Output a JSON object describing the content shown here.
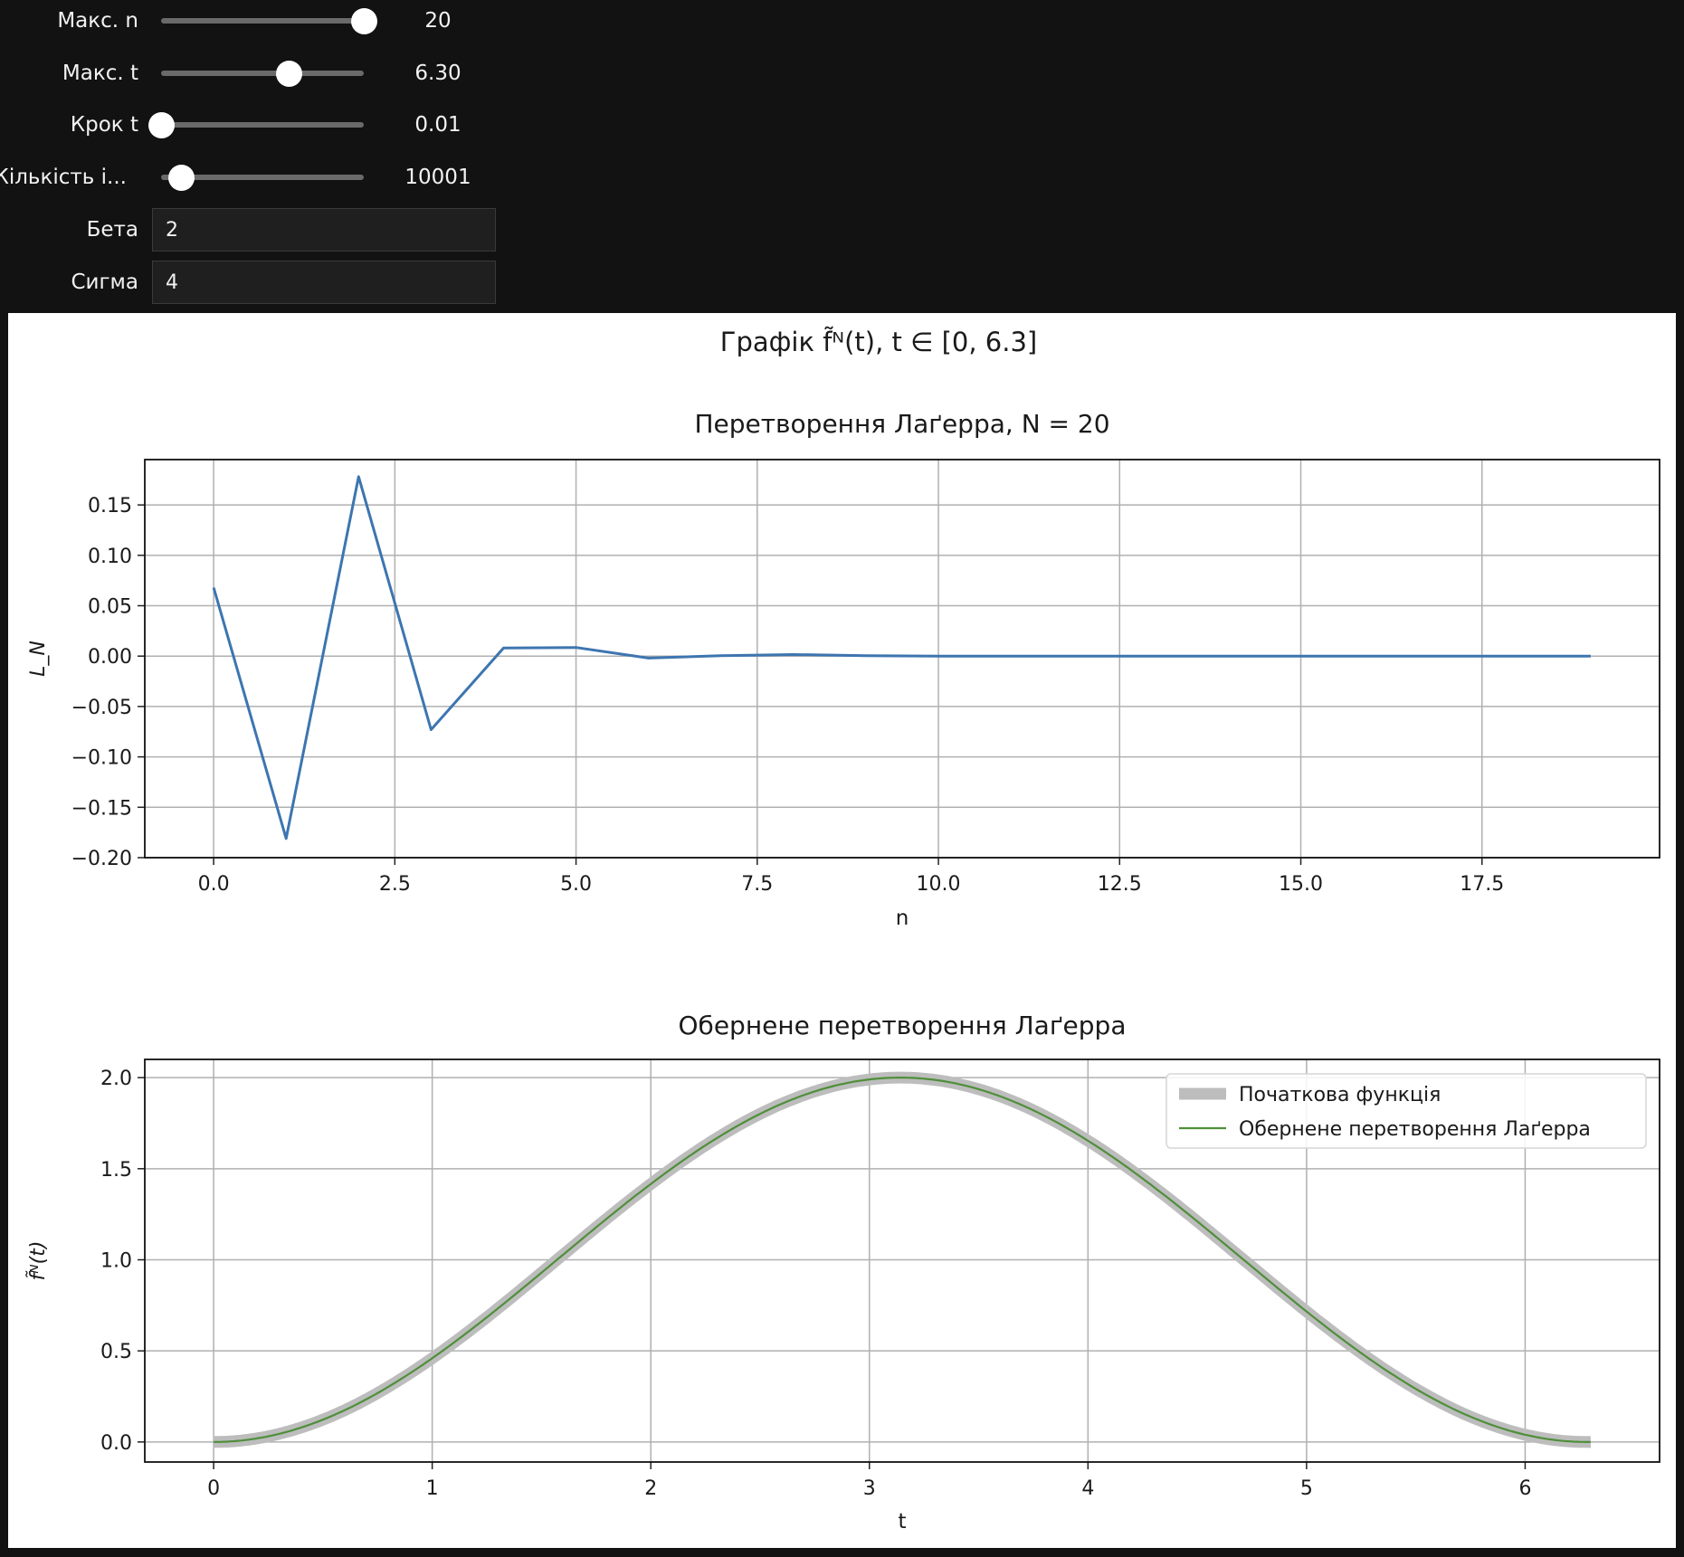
{
  "controls": {
    "sliders": [
      {
        "label": "Макс. n",
        "value_text": "20",
        "fraction": 1.0
      },
      {
        "label": "Макс. t",
        "value_text": "6.30",
        "fraction": 0.63
      },
      {
        "label": "Крок t",
        "value_text": "0.01",
        "fraction": 0.0
      },
      {
        "label": "Кількість і...",
        "value_text": "10001",
        "fraction": 0.1
      }
    ],
    "inputs": [
      {
        "label": "Бета",
        "value": "2"
      },
      {
        "label": "Сигма",
        "value": "4"
      }
    ]
  },
  "figure": {
    "suptitle": "Графік f̃ᴺ(t), t ∈ [0, 6.3]"
  },
  "chart_data": [
    {
      "type": "line",
      "title": "Перетворення Лаґерра, N = 20",
      "xlabel": "n",
      "ylabel": "L_N",
      "xlim": [
        -0.95,
        19.95
      ],
      "ylim": [
        -0.2,
        0.195
      ],
      "xticks": [
        0.0,
        2.5,
        5.0,
        7.5,
        10.0,
        12.5,
        15.0,
        17.5
      ],
      "xtick_labels": [
        "0.0",
        "2.5",
        "5.0",
        "7.5",
        "10.0",
        "12.5",
        "15.0",
        "17.5"
      ],
      "yticks": [
        0.15,
        0.1,
        0.05,
        0.0,
        -0.05,
        -0.1,
        -0.15,
        -0.2
      ],
      "ytick_labels": [
        "0.15",
        "0.10",
        "0.05",
        "0.00",
        "−0.05",
        "−0.10",
        "−0.15",
        "−0.20"
      ],
      "grid": true,
      "series": [
        {
          "color": "#3d75b0",
          "x": [
            0,
            1,
            2,
            3,
            4,
            5,
            6,
            7,
            8,
            9,
            10,
            11,
            12,
            13,
            14,
            15,
            16,
            17,
            18,
            19
          ],
          "y": [
            0.068,
            -0.181,
            0.178,
            -0.073,
            0.008,
            0.0085,
            -0.002,
            0.0005,
            0.0015,
            0.0005,
            0.0,
            0.0,
            0.0,
            0.0,
            0.0,
            0.0,
            0.0,
            0.0,
            0.0,
            0.0
          ]
        }
      ]
    },
    {
      "type": "line",
      "title": "Обернене перетворення Лаґерра",
      "xlabel": "t",
      "ylabel": "f̃ᴺ(t)",
      "xlim": [
        -0.315,
        6.615
      ],
      "ylim": [
        -0.11,
        2.1
      ],
      "xticks": [
        0,
        1,
        2,
        3,
        4,
        5,
        6
      ],
      "xtick_labels": [
        "0",
        "1",
        "2",
        "3",
        "4",
        "5",
        "6"
      ],
      "yticks": [
        2.0,
        1.5,
        1.0,
        0.5,
        0.0
      ],
      "ytick_labels": [
        "2.0",
        "1.5",
        "1.0",
        "0.5",
        "0.0"
      ],
      "grid": true,
      "legend_position": "top-right",
      "series": [
        {
          "name": "Початкова функція",
          "color": "#bdbdbd",
          "function": "1 - cos(t)",
          "t_range": [
            0,
            6.3
          ]
        },
        {
          "name": "Обернене перетворення Лаґерра",
          "color": "#4f8f3a",
          "function": "1 - cos(t)",
          "t_range": [
            0,
            6.3
          ]
        }
      ]
    }
  ]
}
